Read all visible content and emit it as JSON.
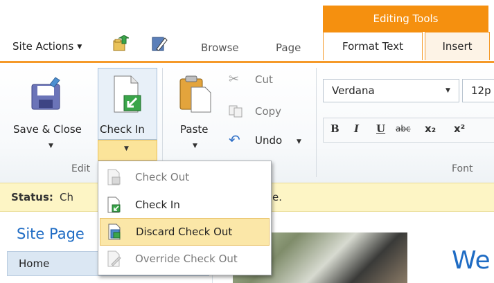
{
  "top": {
    "site_actions": "Site Actions",
    "tabs": [
      "Browse",
      "Page"
    ],
    "context_header": "Editing Tools",
    "context_tabs": [
      "Format Text",
      "Insert"
    ]
  },
  "ribbon": {
    "edit_group": {
      "save_close": "Save & Close",
      "check_in": "Check In",
      "label": "Edit"
    },
    "clipboard_group": {
      "paste": "Paste",
      "cut": "Cut",
      "copy": "Copy",
      "undo": "Undo"
    },
    "font_group": {
      "font_name": "Verdana",
      "font_size": "12p",
      "format_buttons": [
        "B",
        "I",
        "U",
        "abc",
        "x₂",
        "x²"
      ],
      "label": "Font"
    }
  },
  "status": {
    "label": "Status:",
    "text_left": "Ch",
    "text_right": "e."
  },
  "nav": {
    "site_pages": "Site Page",
    "home": "Home"
  },
  "content": {
    "heading_fragment": "We"
  },
  "dropdown": {
    "items": [
      {
        "label": "Check Out",
        "enabled": false
      },
      {
        "label": "Check In",
        "enabled": true
      },
      {
        "label": "Discard Check Out",
        "enabled": true,
        "highlighted": true
      },
      {
        "label": "Override Check Out",
        "enabled": false
      }
    ]
  },
  "colors": {
    "accent_orange": "#f5900f",
    "status_yellow": "#fdf5c5",
    "link_blue": "#1f6cc4",
    "highlight": "#fbe7a8"
  }
}
